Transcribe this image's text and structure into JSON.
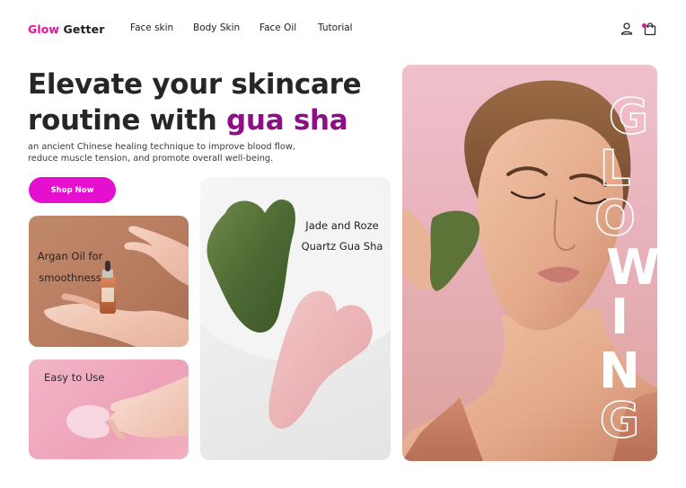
{
  "brand": {
    "first": "Glow",
    "second": " Getter",
    "accent_color": "#e2149f"
  },
  "nav": {
    "links": [
      "Face skin",
      "Body Skin",
      "Face Oil",
      "Tutorial"
    ],
    "icons": [
      "user-icon",
      "shopping-bag-icon"
    ]
  },
  "hero": {
    "headline_part1": "Elevate your skincare routine with ",
    "headline_highlight": "gua sha",
    "subtext": "an ancient Chinese healing technique to improve blood flow, reduce muscle tension, and promote overall well-being.",
    "cta_label": "Shop Now",
    "cta_color": "#e40fcf"
  },
  "cards": {
    "argan": {
      "line1": "Argan Oil for",
      "line2": "smoothness"
    },
    "easy": {
      "label": "Easy to Use"
    },
    "jade": {
      "line1": "Jade and Roze",
      "line2": "Quartz Gua Sha"
    }
  },
  "vertical_word": {
    "text": "GLOWING",
    "letters": [
      "G",
      "L",
      "O",
      "W",
      "I",
      "N",
      "G"
    ]
  }
}
